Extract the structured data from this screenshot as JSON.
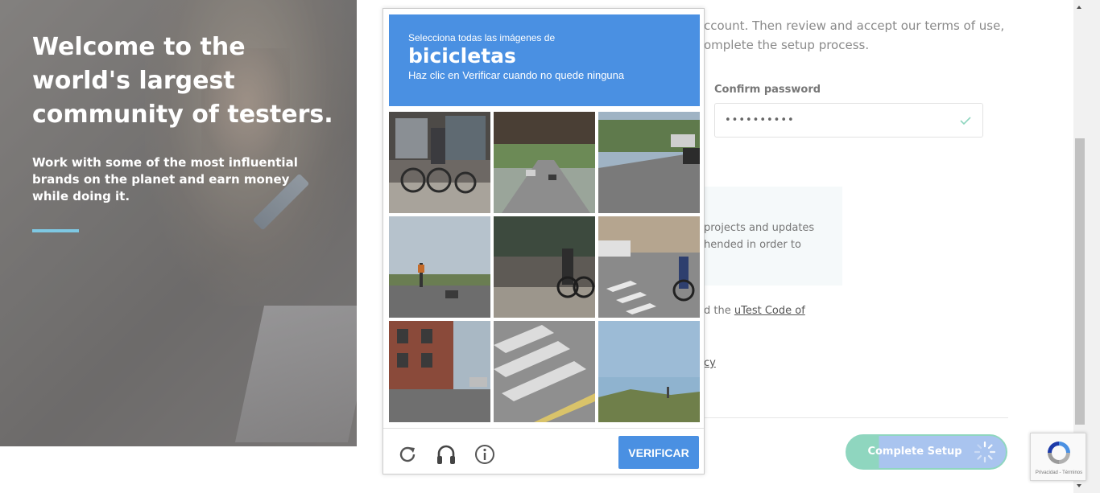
{
  "hero": {
    "title": "Welcome to the world's largest community of testers.",
    "subtitle": "Work with some of the most influential brands on the planet and earn money while doing it."
  },
  "form": {
    "intro": "ccount. Then review and accept our terms of use, omplete the setup process.",
    "confirm_label": "Confirm password",
    "confirm_value": "••••••••••",
    "info": " projects and updates hended in order to",
    "terms_prefix": "d the ",
    "terms_link": "uTest Code of",
    "privacy_fragment": "cy",
    "submit_label": "Complete Setup"
  },
  "captcha": {
    "instruction": "Selecciona todas las imágenes de",
    "keyword": "bicicletas",
    "hint": "Haz clic en Verificar cuando no quede ninguna",
    "verify_label": "VERIFICAR",
    "icons": [
      "reload-icon",
      "audio-icon",
      "info-icon"
    ],
    "tiles": [
      "storefront-bikes",
      "highway-underpass",
      "parking-street",
      "intersection-traffic-light",
      "sidewalk-cyclist",
      "crosswalk-cyclist",
      "brick-building-corner",
      "crosswalk-stripes",
      "sky-grass"
    ]
  },
  "recaptcha_badge": {
    "links": "Privacidad - Términos"
  },
  "colors": {
    "captcha_blue": "#4a90e2",
    "accent_cyan": "#7ec8e3",
    "success_green": "#8fd6bf"
  }
}
